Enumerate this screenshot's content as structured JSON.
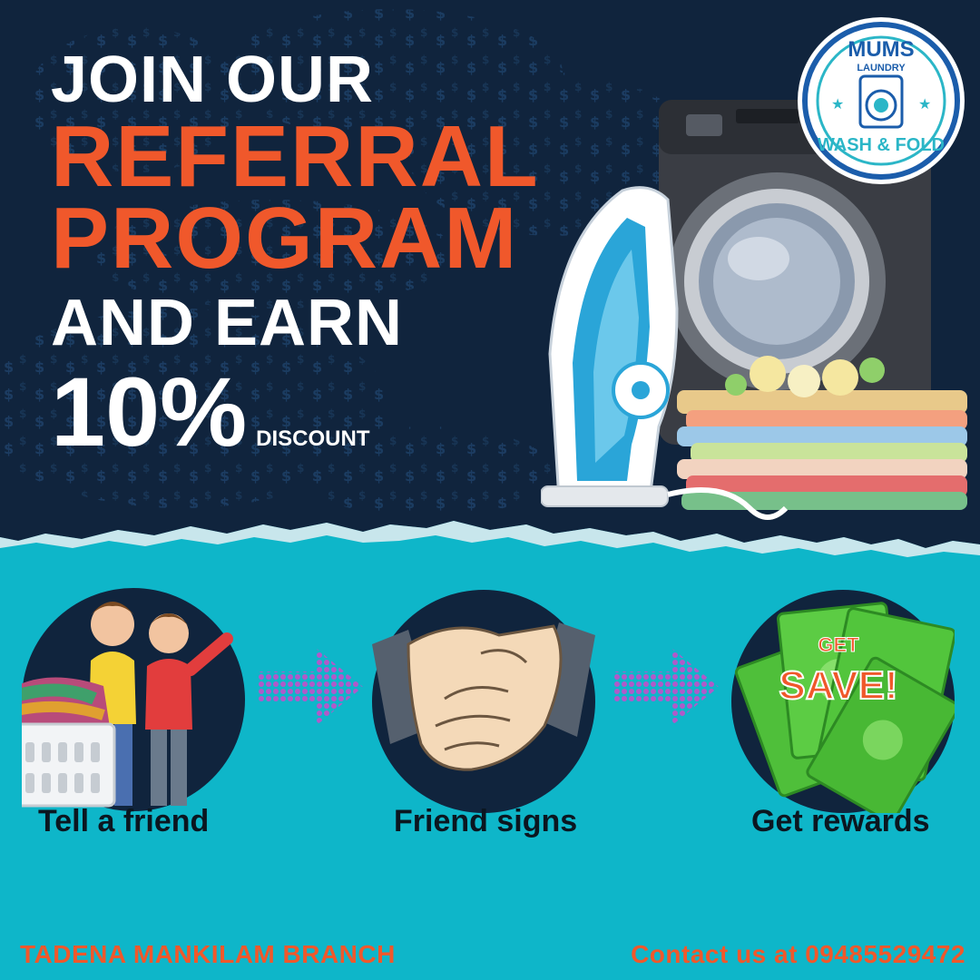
{
  "headline": {
    "line1": "JOIN OUR",
    "line2": "REFERRAL",
    "line3": "PROGRAM",
    "line4": "AND EARN",
    "percent": "10%",
    "discount": "DISCOUNT"
  },
  "logo": {
    "top": "MUMS",
    "sub": "LAUNDRY",
    "bottom": "WASH & FOLD"
  },
  "steps": [
    {
      "label": "Tell a friend",
      "icon": "friends-laundry-icon"
    },
    {
      "label": "Friend signs",
      "icon": "handshake-icon"
    },
    {
      "label": "Get rewards",
      "icon": "cash-rewards-icon"
    }
  ],
  "rewards_badge": {
    "top": "GET",
    "main": "SAVE!"
  },
  "footer": {
    "branch": "TADENA MANKILAM BRANCH",
    "contact": "Contact us at 09485529472"
  },
  "colors": {
    "navy": "#10243d",
    "teal": "#0eb6c9",
    "orange": "#f0582b",
    "white": "#ffffff",
    "arrow_purple": "#b05ac9"
  }
}
